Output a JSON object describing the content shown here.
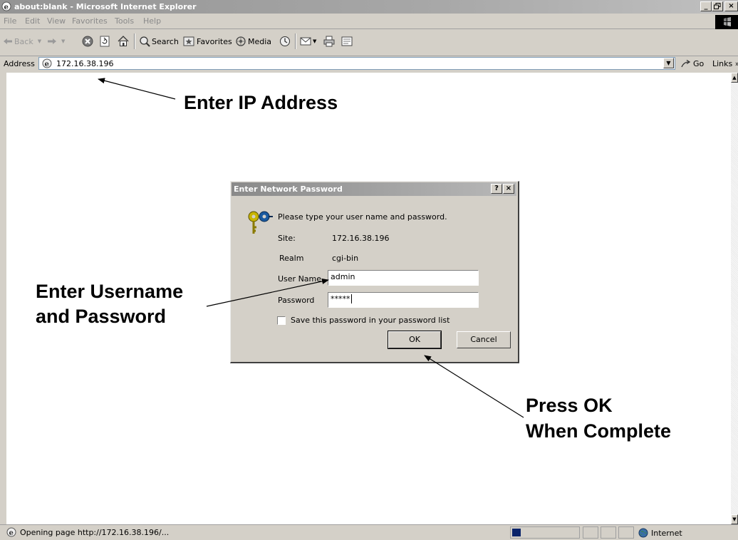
{
  "window": {
    "title": "about:blank - Microsoft Internet Explorer",
    "controls": {
      "minimize": "_",
      "maximize": "\u0001",
      "close": "×"
    }
  },
  "menu": [
    "File",
    "Edit",
    "View",
    "Favorites",
    "Tools",
    "Help"
  ],
  "toolbar": {
    "back": "Back",
    "search": "Search",
    "favorites": "Favorites",
    "media": "Media"
  },
  "address": {
    "label": "Address",
    "value": "172.16.38.196",
    "go": "Go",
    "links": "Links"
  },
  "dialog": {
    "title": "Enter Network Password",
    "prompt": "Please type your user name and password.",
    "site_label": "Site:",
    "site_value": "172.16.38.196",
    "realm_label": "Realm",
    "realm_value": "cgi-bin",
    "username_label": "User Name",
    "username_value": "admin",
    "password_label": "Password",
    "password_value": "*****",
    "save_password_label": "Save this password in your password list",
    "save_password_checked": false,
    "ok_label": "OK",
    "cancel_label": "Cancel"
  },
  "annotations": {
    "ip": "Enter IP Address",
    "credentials_line1": "Enter Username",
    "credentials_line2": "and Password",
    "ok_line1": "Press OK",
    "ok_line2": "When Complete"
  },
  "status": {
    "text": "Opening page http://172.16.38.196/...",
    "zone": "Internet"
  },
  "colors": {
    "background": "#ffffff",
    "chrome": "#d4d0c8",
    "progress": "#0a246a"
  }
}
